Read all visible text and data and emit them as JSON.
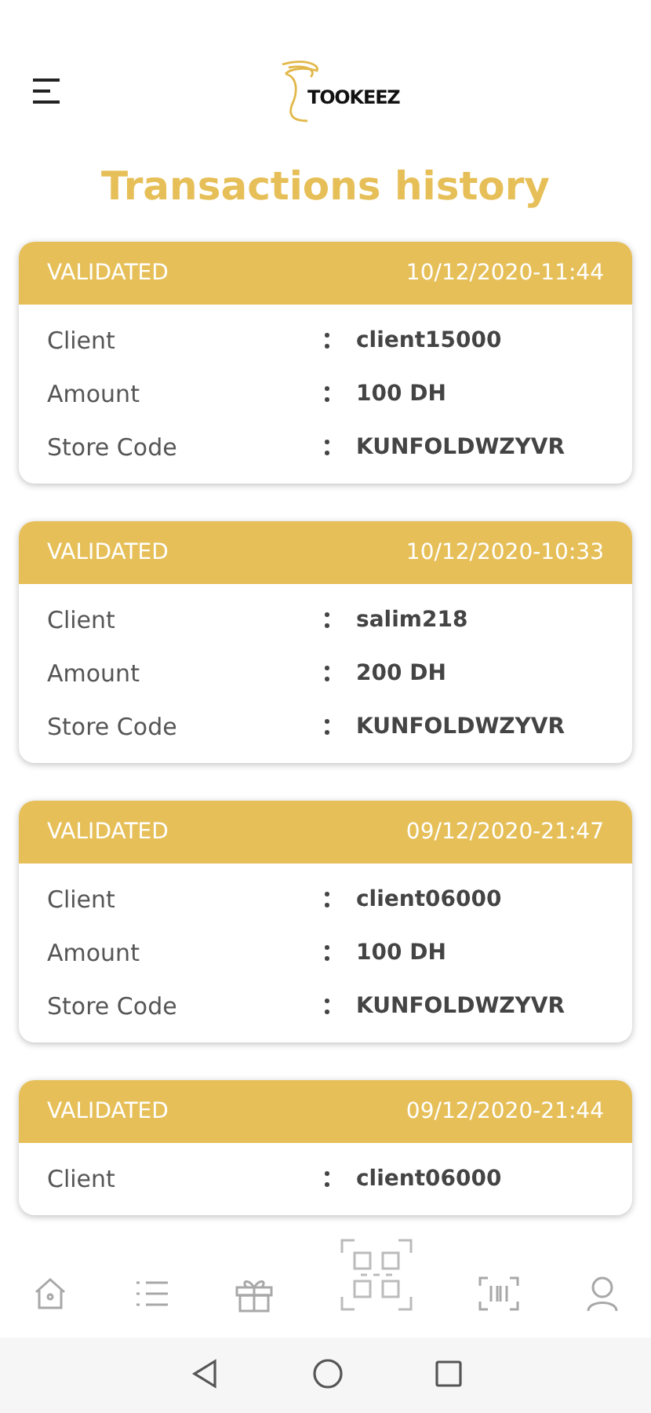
{
  "header": {
    "logo": "TOOKEEZ"
  },
  "title": "Transactions history",
  "transactions": [
    {
      "status": "VALIDATED",
      "date": "10/12/2020-11:44",
      "rows": [
        {
          "label": "Client",
          "value": "client15000"
        },
        {
          "label": "Amount",
          "value": "100 DH"
        },
        {
          "label": "Store Code",
          "value": "KUNFOLDWZYVR"
        }
      ]
    },
    {
      "status": "VALIDATED",
      "date": "10/12/2020-10:33",
      "rows": [
        {
          "label": "Client",
          "value": "salim218"
        },
        {
          "label": "Amount",
          "value": "200 DH"
        },
        {
          "label": "Store Code",
          "value": "KUNFOLDWZYVR"
        }
      ]
    },
    {
      "status": "VALIDATED",
      "date": "09/12/2020-21:47",
      "rows": [
        {
          "label": "Client",
          "value": "client06000"
        },
        {
          "label": "Amount",
          "value": "100 DH"
        },
        {
          "label": "Store Code",
          "value": "KUNFOLDWZYVR"
        }
      ]
    },
    {
      "status": "VALIDATED",
      "date": "09/12/2020-21:44",
      "rows": [
        {
          "label": "Client",
          "value": "client06000"
        }
      ]
    }
  ],
  "bottom_nav": [
    {
      "kind": "home"
    },
    {
      "kind": "list"
    },
    {
      "kind": "gift"
    },
    {
      "kind": "qr"
    },
    {
      "kind": "barcode"
    },
    {
      "kind": "user"
    }
  ],
  "system_nav": [
    {
      "kind": "back"
    },
    {
      "kind": "home"
    },
    {
      "kind": "recents"
    }
  ]
}
